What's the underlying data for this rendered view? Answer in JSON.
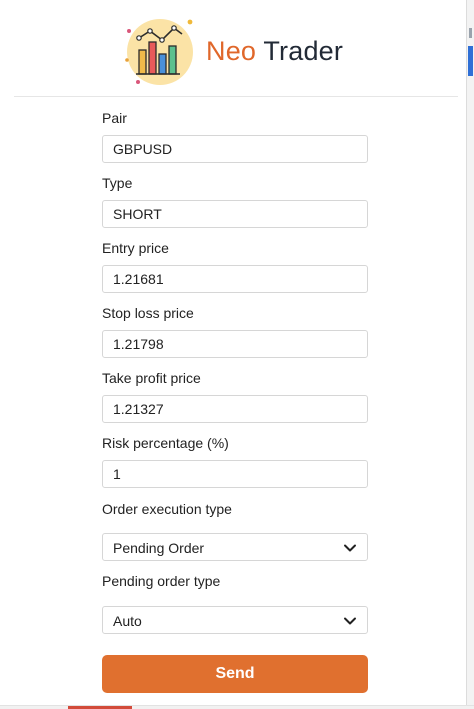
{
  "brand": {
    "first": "Neo",
    "second": "Trader",
    "accent_color": "#e0672a"
  },
  "form": {
    "pair": {
      "label": "Pair",
      "value": "GBPUSD"
    },
    "type": {
      "label": "Type",
      "value": "SHORT"
    },
    "entry_price": {
      "label": "Entry price",
      "value": "1.21681"
    },
    "stop_loss_price": {
      "label": "Stop loss price",
      "value": "1.21798"
    },
    "take_profit_price": {
      "label": "Take profit price",
      "value": "1.21327"
    },
    "risk_percentage": {
      "label": "Risk percentage (%)",
      "value": "1"
    },
    "order_execution_type": {
      "label": "Order execution type",
      "value": "Pending Order"
    },
    "pending_order_type": {
      "label": "Pending order type",
      "value": "Auto"
    }
  },
  "send_button": {
    "label": "Send",
    "color": "#e0702f"
  }
}
